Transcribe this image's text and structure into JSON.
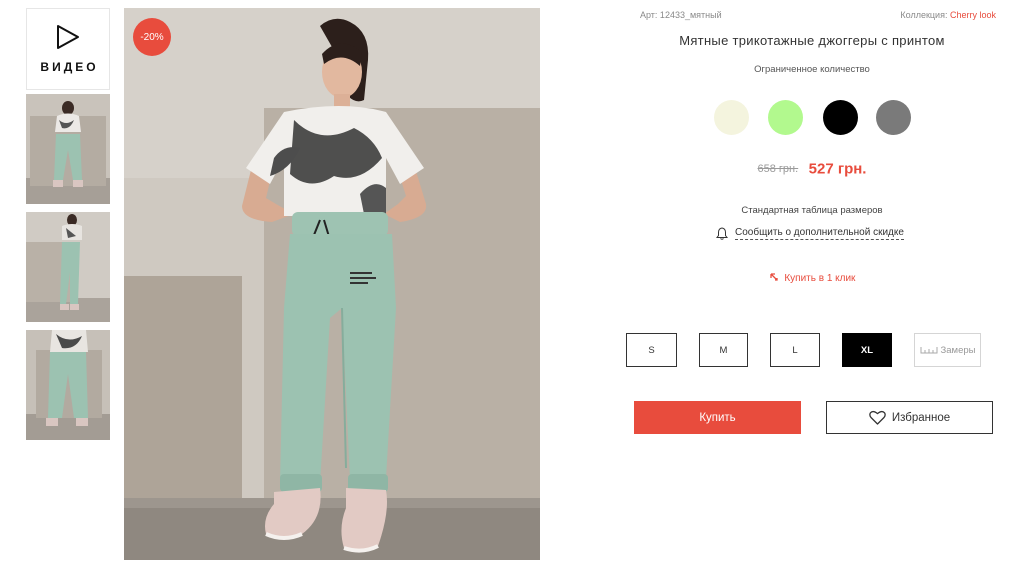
{
  "video_label": "ВИДЕО",
  "discount_badge": "-20%",
  "product": {
    "article": "Арт: 12433_мятный",
    "collection_label": "Коллекция:",
    "collection_value": "Cherry look",
    "title": "Мятные трикотажные джоггеры с принтом",
    "availability": "Ограниченное количество"
  },
  "colors": [
    "#f4f4de",
    "#b2f98e",
    "#000000",
    "#7a7a7a"
  ],
  "price": {
    "old": "658 грн.",
    "new": "527 грн."
  },
  "links": {
    "size_chart": "Стандартная таблица размеров",
    "notify_discount": "Сообщить о дополнительной скидке",
    "one_click": "Купить в 1 клик"
  },
  "sizes": {
    "s": "S",
    "m": "M",
    "l": "L",
    "xl": "XL",
    "measurements": "Замеры",
    "selected": "XL"
  },
  "actions": {
    "buy": "Купить",
    "favorites": "Избранное"
  },
  "accent_color": "#e84c3d"
}
